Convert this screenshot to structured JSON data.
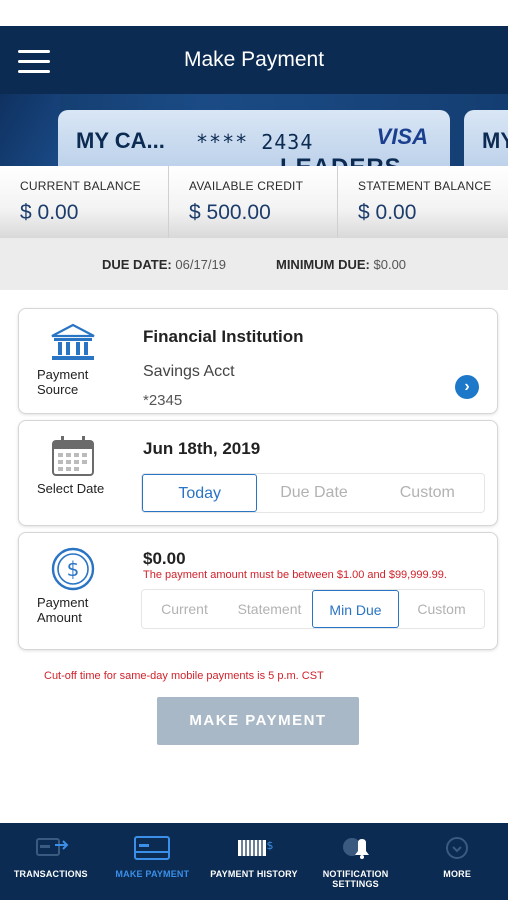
{
  "header": {
    "title": "Make Payment"
  },
  "card": {
    "name": "MY CA...",
    "number": "**** 2434",
    "brand": "VISA",
    "logo_text": "LEADERS",
    "next_name": "MY"
  },
  "balances": [
    {
      "label": "CURRENT BALANCE",
      "value": "$ 0.00"
    },
    {
      "label": "AVAILABLE CREDIT",
      "value": "$ 500.00"
    },
    {
      "label": "STATEMENT BALANCE",
      "value": "$ 0.00"
    }
  ],
  "due": {
    "date_label": "DUE DATE:",
    "date_value": "06/17/19",
    "min_label": "MINIMUM DUE:",
    "min_value": "$0.00"
  },
  "payment_source": {
    "label": "Payment Source",
    "title": "Financial Institution",
    "account": "Savings Acct",
    "number": "*2345"
  },
  "select_date": {
    "label": "Select Date",
    "value": "Jun 18th, 2019",
    "options": [
      "Today",
      "Due Date",
      "Custom"
    ],
    "selected": "Today"
  },
  "payment_amount": {
    "label": "Payment Amount",
    "value": "$0.00",
    "error": "The payment amount must be between $1.00 and $99,999.99.",
    "options": [
      "Current",
      "Statement",
      "Min Due",
      "Custom"
    ],
    "selected": "Min Due"
  },
  "cutoff_note": "Cut-off time for same-day mobile payments is 5 p.m. CST",
  "make_payment_button": "MAKE PAYMENT",
  "bottom_nav": [
    {
      "label": "TRANSACTIONS",
      "icon": "transactions-icon"
    },
    {
      "label": "MAKE PAYMENT",
      "icon": "card-payment-icon"
    },
    {
      "label": "PAYMENT HISTORY",
      "icon": "payment-history-icon"
    },
    {
      "label": "NOTIFICATION SETTINGS",
      "icon": "notification-bell-icon"
    },
    {
      "label": "MORE",
      "icon": "more-icon"
    }
  ],
  "colors": {
    "header_bg": "#0b2b52",
    "accent": "#2a74c4",
    "error": "#d1222b",
    "button_disabled": "#a9b8c7"
  }
}
